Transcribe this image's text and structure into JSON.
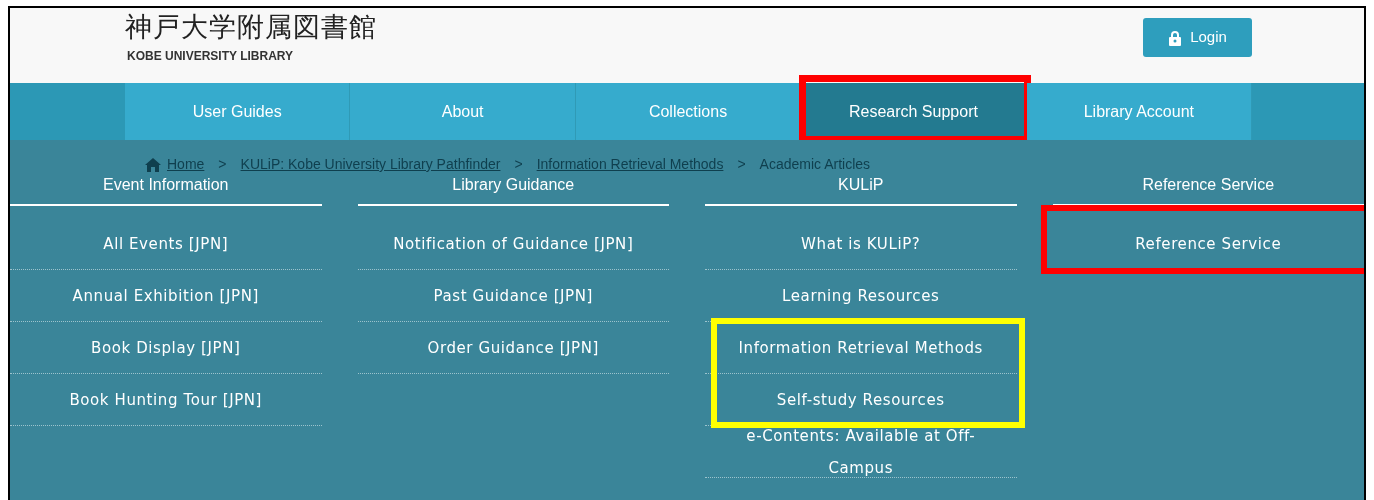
{
  "header": {
    "title_jp": "神戸大学附属図書館",
    "title_en": "KOBE UNIVERSITY LIBRARY",
    "login": "Login"
  },
  "nav": [
    {
      "label": "User Guides",
      "selected": false
    },
    {
      "label": "About",
      "selected": false
    },
    {
      "label": "Collections",
      "selected": false
    },
    {
      "label": "Research Support",
      "selected": true,
      "color": "#ff0000"
    },
    {
      "label": "Library Account",
      "selected": false
    }
  ],
  "breadcrumb": [
    {
      "label": "Home",
      "kind": "link"
    },
    {
      "label": ">",
      "kind": "separator"
    },
    {
      "label": "KULiP: Kobe University Library Pathfinder",
      "kind": "link"
    },
    {
      "label": ">",
      "kind": "separator"
    },
    {
      "label": "Information Retrieval Methods",
      "kind": "link"
    },
    {
      "label": ">",
      "kind": "separator"
    },
    {
      "label": "Academic Articles",
      "kind": "current"
    }
  ],
  "menu": [
    {
      "heading": "Event Information",
      "items": [
        {
          "label": "All Events [JPN]"
        },
        {
          "label": "Annual Exhibition [JPN]"
        },
        {
          "label": "Book Display [JPN]"
        },
        {
          "label": "Book Hunting Tour [JPN]"
        }
      ]
    },
    {
      "heading": "Library Guidance",
      "items": [
        {
          "label": "Notification of Guidance [JPN]"
        },
        {
          "label": "Past Guidance [JPN]"
        },
        {
          "label": "Order Guidance [JPN]"
        }
      ]
    },
    {
      "heading": "KULiP",
      "items": [
        {
          "label": "What is KULiP?"
        },
        {
          "label": "Learning Resources"
        },
        {
          "label": "Information Retrieval Methods",
          "color": "#ffff00"
        },
        {
          "label": "Self-study Resources",
          "color": "#ffff00"
        },
        {
          "label": "e-Contents: Available at Off-Campus"
        }
      ]
    },
    {
      "heading": "Reference Service",
      "items": [
        {
          "label": "Reference Service",
          "color": "#ff0000"
        }
      ]
    }
  ]
}
